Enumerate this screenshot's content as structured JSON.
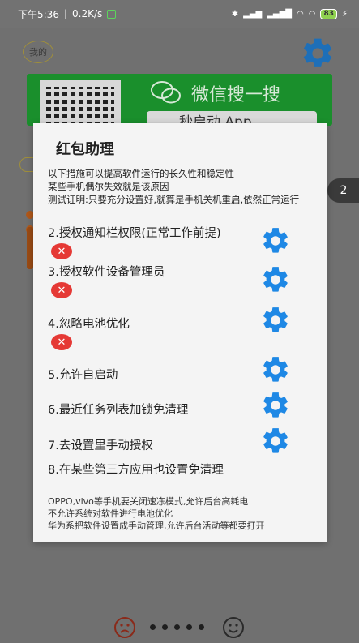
{
  "status_bar": {
    "time": "下午5:36",
    "speed": "0.2K/s",
    "battery": "83"
  },
  "background": {
    "my_label": "我的",
    "wechat_search": "微信搜一搜",
    "search_box_text": "秒启动 App",
    "page_count": "2"
  },
  "dialog": {
    "title": "红包助理",
    "intro": [
      "以下措施可以提高软件运行的长久性和稳定性",
      "某些手机偶尔失效就是该原因",
      "测试证明:只要充分设置好,就算是手机关机重启,依然正常运行"
    ],
    "items": [
      {
        "label": "2.授权通知栏权限(正常工作前提)",
        "status": "✕"
      },
      {
        "label": "3.授权软件设备管理员",
        "status": "✕"
      },
      {
        "label": "4.忽略电池优化",
        "status": "✕"
      },
      {
        "label": "5.允许自启动"
      },
      {
        "label": "6.最近任务列表加锁免清理"
      },
      {
        "label": "7.去设置里手动授权"
      },
      {
        "label": "8.在某些第三方应用也设置免清理"
      }
    ],
    "footer": [
      "OPPO,vivo等手机要关闭速冻模式,允许后台高耗电",
      "不允许系统对软件进行电池优化",
      "华为系把软件设置成手动管理,允许后台活动等都要打开"
    ]
  },
  "colors": {
    "accent_blue": "#1e88e5",
    "error_red": "#e53935",
    "wechat_green": "#1a8f2c"
  }
}
